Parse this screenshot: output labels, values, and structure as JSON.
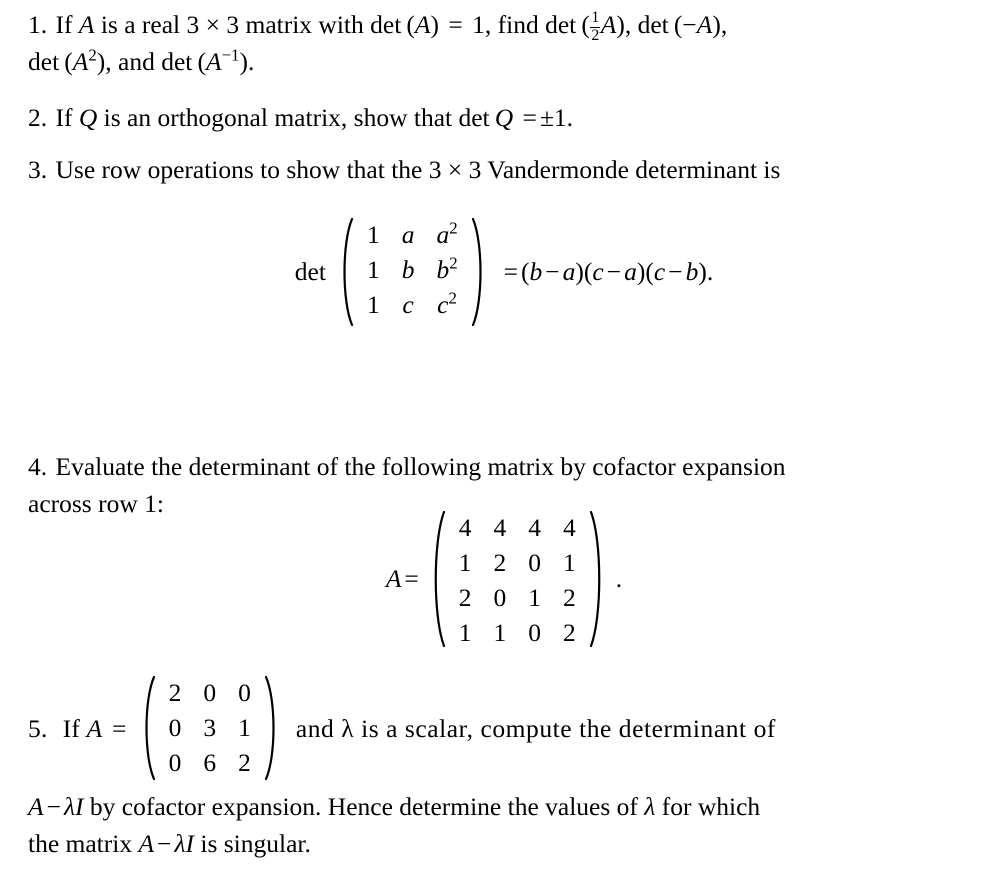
{
  "document": {
    "type": "linear-algebra-problem-set",
    "topic": "determinants",
    "background_color": "#ffffff",
    "text_color": "#000000"
  },
  "problems": [
    {
      "number": "1.",
      "line1_a": "If",
      "var_A": "A",
      "line1_b": "is a real 3 × 3 matrix with",
      "det_rm": "det",
      "paren_open": "(",
      "paren_close": ")",
      "equals": "=",
      "one": "1,",
      "find": "find",
      "frac_num": "1",
      "frac_den": "2",
      "minus": "−",
      "comma": ",",
      "sup_two": "2",
      "sup_minus_one": "−1",
      "and": "and",
      "period": "."
    },
    {
      "number": "2.",
      "text_a": "If",
      "var_Q": "Q",
      "text_b": "is an orthogonal matrix, show that",
      "det_rm": "det",
      "equals": "=",
      "value": "±1.",
      "period": "."
    },
    {
      "number": "3.",
      "text": "Use row operations to show that the 3 × 3 Vandermonde determinant is",
      "equation": {
        "det_label": "det",
        "matrix": [
          [
            "1",
            "a",
            "a2"
          ],
          [
            "1",
            "b",
            "b2"
          ],
          [
            "1",
            "c",
            "c2"
          ]
        ],
        "matrix_plain": [
          [
            "1",
            "a",
            "a²"
          ],
          [
            "1",
            "b",
            "b²"
          ],
          [
            "1",
            "c",
            "c²"
          ]
        ],
        "rhs": "= (b − a)(c − a)(c − b).",
        "rhs_parts": {
          "equals": "=",
          "f1_open": "(",
          "f1_l": "b",
          "f1_op": "−",
          "f1_r": "a",
          "f1_close": ")",
          "f2_open": "(",
          "f2_l": "c",
          "f2_op": "−",
          "f2_r": "a",
          "f2_close": ")",
          "f3_open": "(",
          "f3_l": "c",
          "f3_op": "−",
          "f3_r": "b",
          "f3_close": ")",
          "period": "."
        }
      }
    },
    {
      "number": "4.",
      "line1": "Evaluate the determinant of the following matrix by cofactor expansion",
      "line2": "across row 1:",
      "equation": {
        "lhs_var": "A",
        "lhs_eq": "=",
        "matrix": [
          [
            "4",
            "4",
            "4",
            "4"
          ],
          [
            "1",
            "2",
            "0",
            "1"
          ],
          [
            "2",
            "0",
            "1",
            "2"
          ],
          [
            "1",
            "1",
            "0",
            "2"
          ]
        ],
        "trailing": "."
      }
    },
    {
      "number": "5.",
      "lead_if": "If",
      "lead_var": "A",
      "lead_eq": "=",
      "matrix": [
        [
          "2",
          "0",
          "0"
        ],
        [
          "0",
          "3",
          "1"
        ],
        [
          "0",
          "6",
          "2"
        ]
      ],
      "tail": "and λ is a scalar, compute the determinant of",
      "body_line1": "A − λI by cofactor expansion. Hence determine the values of λ for which",
      "body_line2": "the matrix A − λI is singular.",
      "body_tokens": {
        "A": "A",
        "minus": "−",
        "lambda": "λ",
        "I": "I",
        "t1": "by cofactor expansion.  Hence determine the values of",
        "t2": "for which",
        "t3": "the matrix",
        "t4": "is singular."
      }
    }
  ]
}
